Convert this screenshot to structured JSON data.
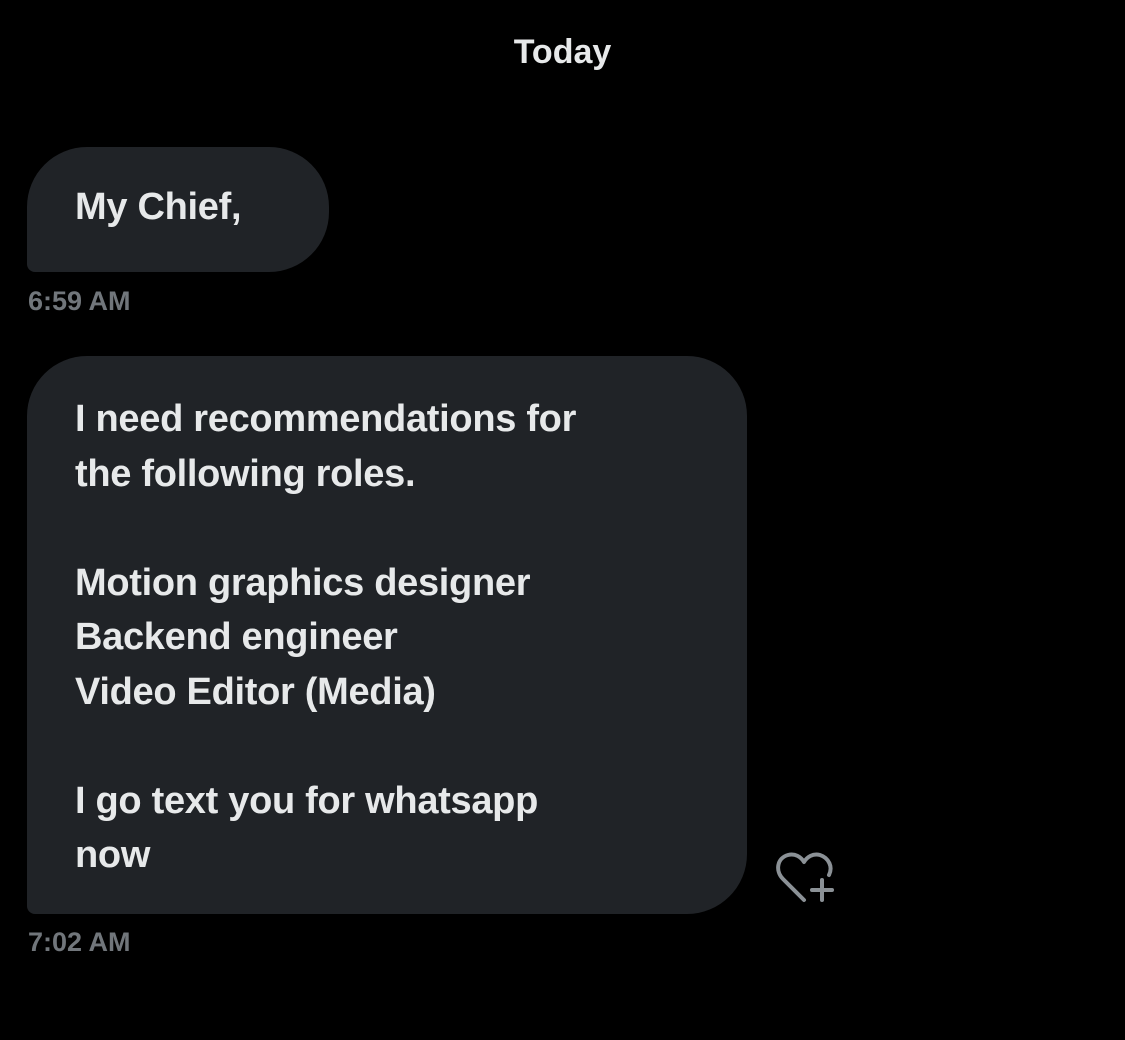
{
  "conversation": {
    "date_divider": "Today",
    "messages": [
      {
        "text": "My Chief,",
        "time": "6:59 AM"
      },
      {
        "text": "I need recommendations for\nthe following roles.\n\nMotion graphics designer\nBackend engineer\nVideo Editor (Media)\n\nI go text you for whatsapp\nnow",
        "time": "7:02 AM"
      }
    ],
    "reaction_icon": "heart-plus-icon"
  },
  "colors": {
    "background": "#000000",
    "bubble": "#202327",
    "text": "#e7e9ea",
    "timestamp": "#71767b"
  }
}
